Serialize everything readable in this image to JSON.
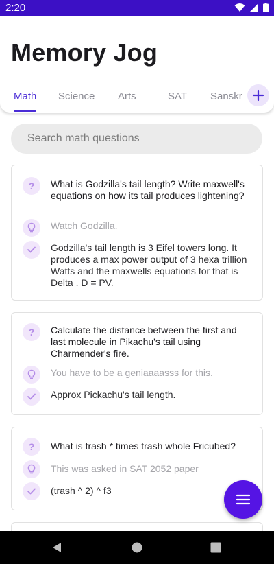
{
  "status_bar": {
    "time": "2:20",
    "background": "#3c10c5",
    "icons": [
      "wifi-icon",
      "signal-icon",
      "battery-icon"
    ]
  },
  "app": {
    "title": "Memory Jog",
    "accent": "#4a2cd6",
    "fab_color": "#5514e4"
  },
  "tabs": [
    {
      "label": "Math",
      "active": true
    },
    {
      "label": "Science",
      "active": false
    },
    {
      "label": "Arts",
      "active": false
    },
    {
      "label": "SAT",
      "active": false
    },
    {
      "label": "Sanskr",
      "active": false
    }
  ],
  "add_tab_icon": "plus-icon",
  "search": {
    "placeholder": "Search math questions"
  },
  "cards": [
    {
      "question": "What is Godzilla's tail length? Write maxwell's equations on how its tail produces lightening?",
      "hint": "Watch Godzilla.",
      "answer": "Godzilla's tail length is 3 Eifel towers long. It produces a max power output of 3 hexa trillion Watts and the maxwells equations for that is Delta . D = PV."
    },
    {
      "question": "Calculate the distance between the first and last molecule in Pikachu's tail using Charmender's fire.",
      "hint": "You have to be a geniaaaasss for this.",
      "answer": "Approx Pickachu's tail length."
    },
    {
      "question": "What is trash * times trash whole Fricubed?",
      "hint": "This was asked in SAT 2052 paper",
      "answer": "(trash ^ 2) ^ f3"
    }
  ],
  "row_icons": {
    "question": "question-mark-icon",
    "hint": "lightbulb-icon",
    "answer": "checkmark-icon"
  },
  "fab_icon": "menu-icon",
  "nav_bar": [
    "back-icon",
    "home-icon",
    "recents-icon"
  ]
}
